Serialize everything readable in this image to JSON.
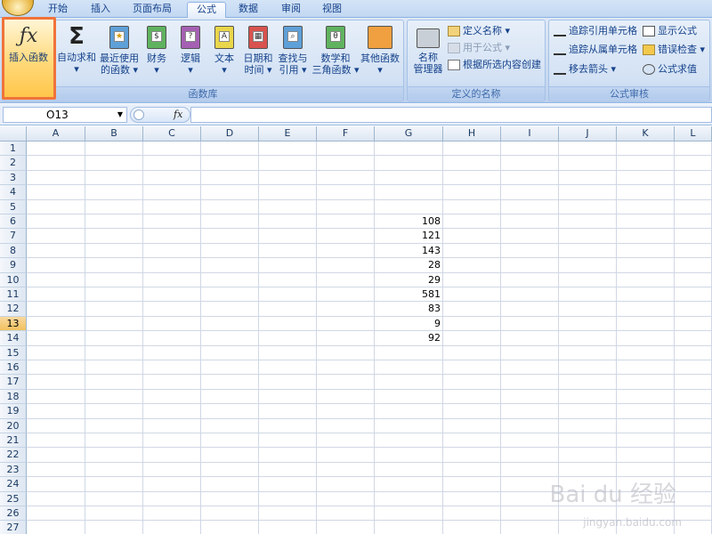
{
  "tabs": [
    "开始",
    "插入",
    "页面布局",
    "公式",
    "数据",
    "审阅",
    "视图"
  ],
  "active_tab": "公式",
  "ribbon": {
    "function_library": {
      "label": "函数库",
      "insert_function": "插入函数",
      "autosum_line1": "自动求和",
      "recent_line1": "最近使用",
      "recent_line2": "的函数",
      "financial": "财务",
      "logical": "逻辑",
      "text": "文本",
      "datetime_line1": "日期和",
      "datetime_line2": "时间",
      "lookup_line1": "查找与",
      "lookup_line2": "引用",
      "math_line1": "数学和",
      "math_line2": "三角函数",
      "other": "其他函数"
    },
    "defined_names": {
      "label": "定义的名称",
      "name_manager_line1": "名称",
      "name_manager_line2": "管理器",
      "define_name": "定义名称",
      "use_in_formula": "用于公式",
      "create_from_selection": "根据所选内容创建"
    },
    "formula_auditing": {
      "label": "公式审核",
      "trace_precedents": "追踪引用单元格",
      "trace_dependents": "追踪从属单元格",
      "remove_arrows": "移去箭头",
      "show_formulas": "显示公式",
      "error_checking": "错误检查",
      "evaluate_formula": "公式求值"
    }
  },
  "formula_bar": {
    "name_box": "O13",
    "fx": "fx",
    "formula": ""
  },
  "columns": [
    "A",
    "B",
    "C",
    "D",
    "E",
    "F",
    "G",
    "H",
    "I",
    "J",
    "K",
    "L"
  ],
  "rows": [
    "1",
    "2",
    "3",
    "4",
    "5",
    "6",
    "7",
    "8",
    "9",
    "10",
    "11",
    "12",
    "13",
    "14",
    "15",
    "16",
    "17",
    "18",
    "19",
    "20",
    "21",
    "22",
    "23",
    "24",
    "25",
    "26",
    "27"
  ],
  "selected_row": "13",
  "cells_G": {
    "6": "108",
    "7": "121",
    "8": "143",
    "9": "28",
    "10": "29",
    "11": "581",
    "12": "83",
    "13": "9",
    "14": "92"
  },
  "watermark": {
    "main": "Bai du 经验",
    "sub": "jingyan.baidu.com"
  },
  "colors": {
    "highlight_border": "#f0733a",
    "ribbon_text": "#15428b"
  }
}
